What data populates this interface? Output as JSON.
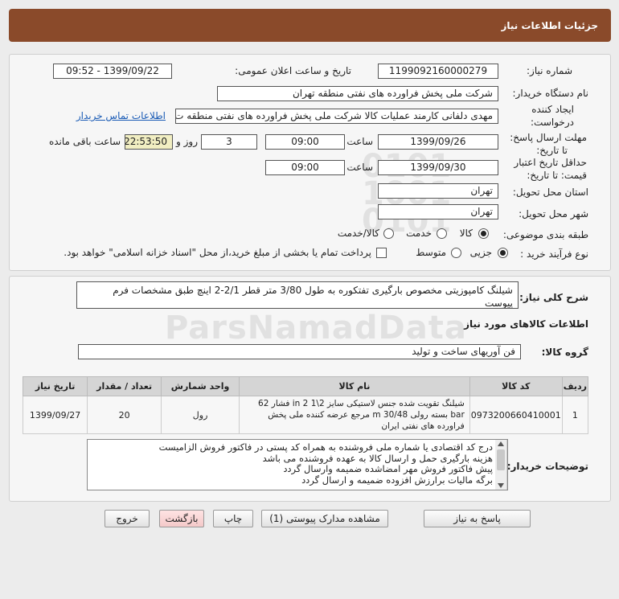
{
  "header": {
    "title": "جزئیات اطلاعات نیاز"
  },
  "form": {
    "need_number_label": "شماره نیاز:",
    "need_number": "1199092160000279",
    "announce_label": "تاریخ و ساعت اعلان عمومی:",
    "announce_value": "1399/09/22 - 09:52",
    "buyer_org_label": "نام دستگاه خریدار:",
    "buyer_org": "شرکت ملی پخش فراورده های نفتی منطقه تهران",
    "creator_label_1": "ایجاد کننده",
    "creator_label_2": "درخواست:",
    "creator": "مهدی دلفانی کارمند عملیات کالا شرکت ملی پخش فراورده های نفتی منطقه ت",
    "contact_link": "اطلاعات تماس خریدار",
    "deadline_label_1": "مهلت ارسال پاسخ:",
    "deadline_label_2": "تا تاریخ:",
    "deadline_date": "1399/09/26",
    "time_label": "ساعت",
    "deadline_time": "09:00",
    "days_value": "3",
    "days_label": "روز و",
    "remaining_value": "22:53:50",
    "remaining_label": "ساعت باقی مانده",
    "validity_label_1": "حداقل تاریخ اعتبار",
    "validity_label_2": "قیمت: تا تاریخ:",
    "validity_date": "1399/09/30",
    "validity_time": "09:00",
    "province_label": "استان محل تحویل:",
    "province": "تهران",
    "city_label": "شهر محل تحویل:",
    "city": "تهران",
    "category_label": "طبقه بندی موضوعی:",
    "cat_goods": "کالا",
    "cat_service": "خدمت",
    "cat_goods_service": "کالا/خدمت",
    "process_label": "نوع فرآیند خرید :",
    "proc_partial": "جزیی",
    "proc_medium": "متوسط",
    "treasury_note": "پرداخت تمام یا بخشی از مبلغ خرید،از محل \"اسناد خزانه اسلامی\" خواهد بود."
  },
  "summary": {
    "label": "شرح کلی نیاز:",
    "text": "شیلنگ کامپوزیتی مخصوص بارگیری تفتکوره به طول 3/80 متر قطر 2/1-2 اینچ طبق مشخصات فرم پیوست"
  },
  "goods": {
    "section_title": "اطلاعات کالاهای مورد نیاز",
    "group_label": "گروه کالا:",
    "group_value": "فن آوریهای ساخت و تولید",
    "columns": [
      "ردیف",
      "کد کالا",
      "نام کالا",
      "واحد شمارش",
      "تعداد / مقدار",
      "تاریخ نیاز"
    ],
    "rows": [
      {
        "row": "1",
        "code": "0973200660410001",
        "name": "شیلنگ تقویت شده جنس لاستیکی سایز 2\\1 2 in فشار 62 bar بسته رولی 30/48 m مرجع عرضه کننده ملی پخش فراورده های نفتی ایران",
        "unit": "رول",
        "qty": "20",
        "date": "1399/09/27"
      }
    ]
  },
  "notes": {
    "label": "توضیحات خریدار:",
    "lines": [
      "درج کد اقتصادی یا شماره ملی فروشنده به همراه کد پستی در فاکتور فروش الزامیست",
      "هزینه بارگیری حمل و ارسال کالا به عهده فروشنده می باشد",
      "پیش فاکتور فروش مهر امضاشده ضمیمه وارسال گردد",
      "برگه مالیات برارزش افزوده ضمیمه و ارسال گردد"
    ]
  },
  "buttons": {
    "reply": "پاسخ به نیاز",
    "attachments": "مشاهده مدارک پیوستی (1)",
    "print": "چاپ",
    "back": "بازگشت",
    "exit": "خروج"
  }
}
